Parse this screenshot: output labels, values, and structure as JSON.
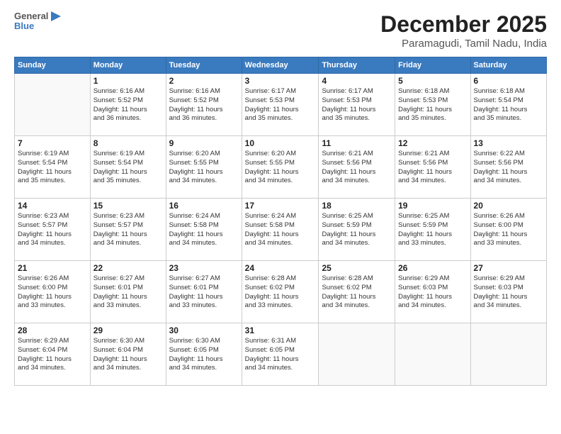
{
  "header": {
    "logo_line1": "General",
    "logo_line2": "Blue",
    "title": "December 2025",
    "subtitle": "Paramagudi, Tamil Nadu, India"
  },
  "weekdays": [
    "Sunday",
    "Monday",
    "Tuesday",
    "Wednesday",
    "Thursday",
    "Friday",
    "Saturday"
  ],
  "weeks": [
    [
      {
        "day": "",
        "info": ""
      },
      {
        "day": "1",
        "info": "Sunrise: 6:16 AM\nSunset: 5:52 PM\nDaylight: 11 hours\nand 36 minutes."
      },
      {
        "day": "2",
        "info": "Sunrise: 6:16 AM\nSunset: 5:52 PM\nDaylight: 11 hours\nand 36 minutes."
      },
      {
        "day": "3",
        "info": "Sunrise: 6:17 AM\nSunset: 5:53 PM\nDaylight: 11 hours\nand 35 minutes."
      },
      {
        "day": "4",
        "info": "Sunrise: 6:17 AM\nSunset: 5:53 PM\nDaylight: 11 hours\nand 35 minutes."
      },
      {
        "day": "5",
        "info": "Sunrise: 6:18 AM\nSunset: 5:53 PM\nDaylight: 11 hours\nand 35 minutes."
      },
      {
        "day": "6",
        "info": "Sunrise: 6:18 AM\nSunset: 5:54 PM\nDaylight: 11 hours\nand 35 minutes."
      }
    ],
    [
      {
        "day": "7",
        "info": "Sunrise: 6:19 AM\nSunset: 5:54 PM\nDaylight: 11 hours\nand 35 minutes."
      },
      {
        "day": "8",
        "info": "Sunrise: 6:19 AM\nSunset: 5:54 PM\nDaylight: 11 hours\nand 35 minutes."
      },
      {
        "day": "9",
        "info": "Sunrise: 6:20 AM\nSunset: 5:55 PM\nDaylight: 11 hours\nand 34 minutes."
      },
      {
        "day": "10",
        "info": "Sunrise: 6:20 AM\nSunset: 5:55 PM\nDaylight: 11 hours\nand 34 minutes."
      },
      {
        "day": "11",
        "info": "Sunrise: 6:21 AM\nSunset: 5:56 PM\nDaylight: 11 hours\nand 34 minutes."
      },
      {
        "day": "12",
        "info": "Sunrise: 6:21 AM\nSunset: 5:56 PM\nDaylight: 11 hours\nand 34 minutes."
      },
      {
        "day": "13",
        "info": "Sunrise: 6:22 AM\nSunset: 5:56 PM\nDaylight: 11 hours\nand 34 minutes."
      }
    ],
    [
      {
        "day": "14",
        "info": "Sunrise: 6:23 AM\nSunset: 5:57 PM\nDaylight: 11 hours\nand 34 minutes."
      },
      {
        "day": "15",
        "info": "Sunrise: 6:23 AM\nSunset: 5:57 PM\nDaylight: 11 hours\nand 34 minutes."
      },
      {
        "day": "16",
        "info": "Sunrise: 6:24 AM\nSunset: 5:58 PM\nDaylight: 11 hours\nand 34 minutes."
      },
      {
        "day": "17",
        "info": "Sunrise: 6:24 AM\nSunset: 5:58 PM\nDaylight: 11 hours\nand 34 minutes."
      },
      {
        "day": "18",
        "info": "Sunrise: 6:25 AM\nSunset: 5:59 PM\nDaylight: 11 hours\nand 34 minutes."
      },
      {
        "day": "19",
        "info": "Sunrise: 6:25 AM\nSunset: 5:59 PM\nDaylight: 11 hours\nand 33 minutes."
      },
      {
        "day": "20",
        "info": "Sunrise: 6:26 AM\nSunset: 6:00 PM\nDaylight: 11 hours\nand 33 minutes."
      }
    ],
    [
      {
        "day": "21",
        "info": "Sunrise: 6:26 AM\nSunset: 6:00 PM\nDaylight: 11 hours\nand 33 minutes."
      },
      {
        "day": "22",
        "info": "Sunrise: 6:27 AM\nSunset: 6:01 PM\nDaylight: 11 hours\nand 33 minutes."
      },
      {
        "day": "23",
        "info": "Sunrise: 6:27 AM\nSunset: 6:01 PM\nDaylight: 11 hours\nand 33 minutes."
      },
      {
        "day": "24",
        "info": "Sunrise: 6:28 AM\nSunset: 6:02 PM\nDaylight: 11 hours\nand 33 minutes."
      },
      {
        "day": "25",
        "info": "Sunrise: 6:28 AM\nSunset: 6:02 PM\nDaylight: 11 hours\nand 34 minutes."
      },
      {
        "day": "26",
        "info": "Sunrise: 6:29 AM\nSunset: 6:03 PM\nDaylight: 11 hours\nand 34 minutes."
      },
      {
        "day": "27",
        "info": "Sunrise: 6:29 AM\nSunset: 6:03 PM\nDaylight: 11 hours\nand 34 minutes."
      }
    ],
    [
      {
        "day": "28",
        "info": "Sunrise: 6:29 AM\nSunset: 6:04 PM\nDaylight: 11 hours\nand 34 minutes."
      },
      {
        "day": "29",
        "info": "Sunrise: 6:30 AM\nSunset: 6:04 PM\nDaylight: 11 hours\nand 34 minutes."
      },
      {
        "day": "30",
        "info": "Sunrise: 6:30 AM\nSunset: 6:05 PM\nDaylight: 11 hours\nand 34 minutes."
      },
      {
        "day": "31",
        "info": "Sunrise: 6:31 AM\nSunset: 6:05 PM\nDaylight: 11 hours\nand 34 minutes."
      },
      {
        "day": "",
        "info": ""
      },
      {
        "day": "",
        "info": ""
      },
      {
        "day": "",
        "info": ""
      }
    ]
  ]
}
